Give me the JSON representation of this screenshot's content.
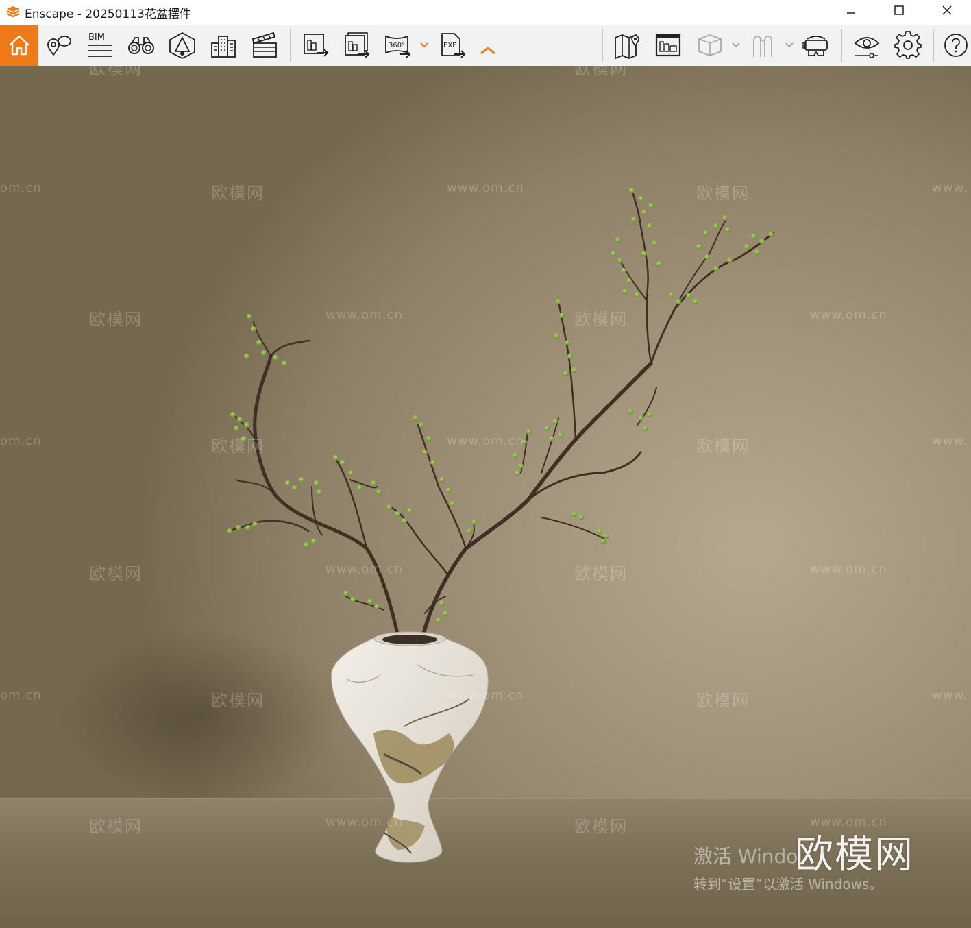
{
  "window": {
    "title": "Enscape - 20250113花盆摆件",
    "controls": [
      "minimize",
      "maximize",
      "close"
    ]
  },
  "toolbar": {
    "bim_label": "BIM",
    "panorama_label": "360°",
    "exe_label": "EXE",
    "left_buttons": [
      "home-icon",
      "location-icon",
      "bim-icon",
      "binoculars-icon",
      "perspective-icon",
      "buildings-icon",
      "clapper-icon"
    ],
    "export_buttons": [
      "screenshot-export-icon",
      "batch-export-icon",
      "panorama-export-icon",
      "exe-export-icon"
    ],
    "right_buttons": [
      "map-icon",
      "asset-library-icon",
      "cube-icon",
      "people-icon",
      "vr-headset-icon",
      "visibility-icon",
      "settings-icon",
      "help-icon"
    ],
    "accent_color": "#f07a17"
  },
  "viewport": {
    "watermark_text": "欧模网",
    "watermark_url": "www.om.cn",
    "watermark_url_partial": "om.cn",
    "watermark_url_edge": "www.",
    "brand_watermark": "欧模网",
    "activation_title": "激活 Windo",
    "activation_subtitle": "转到“设置”以激活 Windows。"
  }
}
